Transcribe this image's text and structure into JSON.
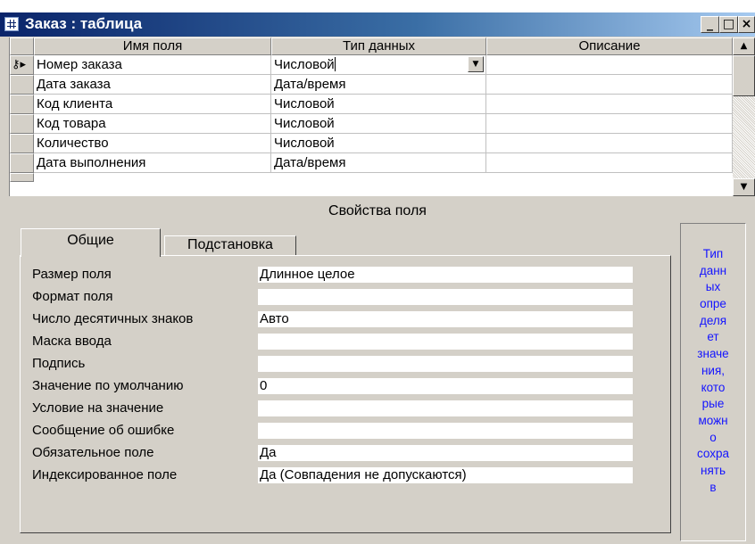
{
  "window": {
    "title": "Заказ : таблица",
    "buttons": {
      "minimize": "_",
      "maximize": "□",
      "close": "×"
    }
  },
  "grid": {
    "headers": [
      "Имя поля",
      "Тип данных",
      "Описание"
    ],
    "rows": [
      {
        "name": "Номер заказа",
        "type": "Числовой",
        "description": ""
      },
      {
        "name": "Дата заказа",
        "type": "Дата/время",
        "description": ""
      },
      {
        "name": "Код клиента",
        "type": "Числовой",
        "description": ""
      },
      {
        "name": "Код товара",
        "type": "Числовой",
        "description": ""
      },
      {
        "name": "Количество",
        "type": "Числовой",
        "description": ""
      },
      {
        "name": "Дата выполнения",
        "type": "Дата/время",
        "description": ""
      }
    ]
  },
  "properties": {
    "title": "Свойства поля",
    "tabs": [
      "Общие",
      "Подстановка"
    ],
    "fields": [
      {
        "label": "Размер поля",
        "value": "Длинное целое"
      },
      {
        "label": "Формат поля",
        "value": ""
      },
      {
        "label": "Число десятичных знаков",
        "value": "Авто"
      },
      {
        "label": "Маска ввода",
        "value": ""
      },
      {
        "label": "Подпись",
        "value": ""
      },
      {
        "label": "Значение по умолчанию",
        "value": "0"
      },
      {
        "label": "Условие на значение",
        "value": ""
      },
      {
        "label": "Сообщение об ошибке",
        "value": ""
      },
      {
        "label": "Обязательное поле",
        "value": "Да"
      },
      {
        "label": "Индексированное поле",
        "value": "Да (Совпадения не допускаются)"
      }
    ]
  },
  "help": {
    "lines": [
      "Тип",
      "данн",
      "ых",
      "опре",
      "деля",
      "ет",
      "значе",
      "ния,",
      "кото",
      "рые",
      "можн",
      "о",
      "сохра",
      "нять",
      "в"
    ]
  },
  "colors": {
    "title_start": "#0a246a",
    "title_end": "#a6caf0",
    "help_text": "#1414ff",
    "chrome": "#d4d0c8"
  }
}
